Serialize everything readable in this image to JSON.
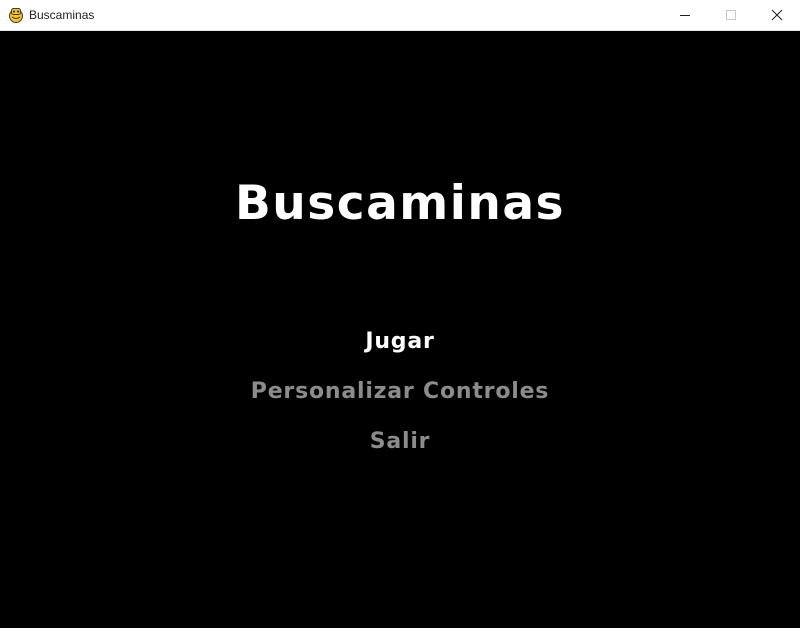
{
  "window": {
    "title": "Buscaminas",
    "app_icon": "pygame-snake-icon",
    "controls": {
      "minimize_icon": "minimize-icon",
      "maximize_icon": "maximize-icon",
      "close_icon": "close-icon"
    }
  },
  "game": {
    "title": "Buscaminas",
    "background_color": "#000000",
    "title_color": "#ffffff",
    "menu": {
      "selected_color": "#ffffff",
      "unselected_color": "#8c8c8c",
      "items": [
        {
          "label": "Jugar",
          "selected": true
        },
        {
          "label": "Personalizar Controles",
          "selected": false
        },
        {
          "label": "Salir",
          "selected": false
        }
      ]
    }
  }
}
